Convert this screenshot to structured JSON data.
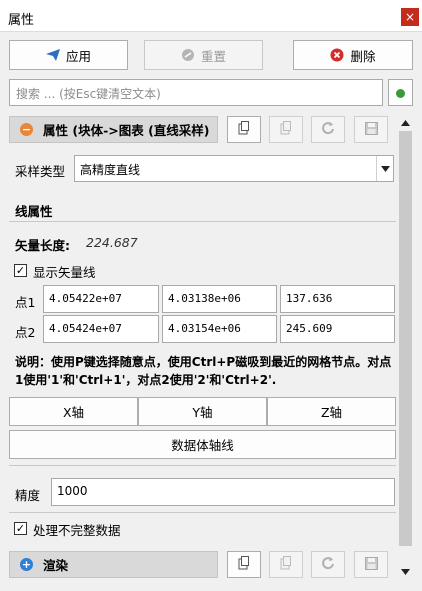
{
  "window": {
    "title": "属性",
    "close_glyph": "×"
  },
  "toolbar": {
    "apply_label": "应用",
    "reset_label": "重置",
    "delete_label": "删除"
  },
  "search": {
    "placeholder": "搜索 ... (按Esc键清空文本)"
  },
  "properties_panel": {
    "header": "属性 (块体->图表 (直线采样)",
    "sampling_type_label": "采样类型",
    "sampling_type_value": "高精度直线",
    "line_props_title": "线属性",
    "vector_length_label": "矢量长度:",
    "vector_length_value": "224.687",
    "show_vector_label": "显示矢量线",
    "show_vector_checked": true,
    "point1_label": "点1",
    "point1": [
      "4.05422e+07",
      "4.03138e+06",
      "137.636"
    ],
    "point2_label": "点2",
    "point2": [
      "4.05424e+07",
      "4.03154e+06",
      "245.609"
    ],
    "note": "说明：使用P键选择随意点，使用Ctrl+P磁吸到最近的网格节点。对点1使用'1'和'Ctrl+1'，对点2使用'2'和'Ctrl+2'.",
    "x_axis_label": "X轴",
    "y_axis_label": "Y轴",
    "z_axis_label": "Z轴",
    "data_axis_label": "数据体轴线",
    "precision_label": "精度",
    "precision_value": "1000",
    "incomplete_label": "处理不完整数据",
    "incomplete_checked": true
  },
  "render_panel": {
    "header": "渲染"
  },
  "colors": {
    "apply_icon": "#2b6cc4",
    "delete_icon": "#d42b2b",
    "collapse_icon": "#e8863a",
    "expand_icon": "#2e7fd6",
    "status_dot": "#3a9a3a"
  }
}
